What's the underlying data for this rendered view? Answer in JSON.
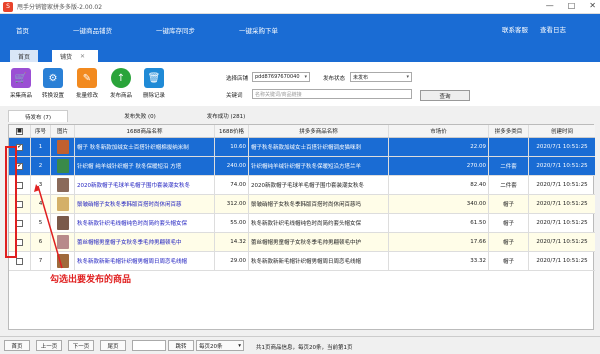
{
  "window": {
    "title": "甩手分销管家拼多多版-2.00.02",
    "controls": [
      "—",
      "□",
      "✕"
    ]
  },
  "topnav": {
    "items": [
      "首页",
      "一键商品铺货",
      "一键库存同步",
      "一键采购下单"
    ],
    "right": [
      "联系客服",
      "查看日志"
    ]
  },
  "tabs": [
    {
      "label": "首页"
    },
    {
      "label": "铺货",
      "close": "✕"
    }
  ],
  "toolbar": {
    "buttons": [
      {
        "label": "采集商品",
        "icon": "cart-icon",
        "color": "#9b4fd4"
      },
      {
        "label": "转换设置",
        "icon": "gear-icon",
        "color": "#2a80d6"
      },
      {
        "label": "批量修改",
        "icon": "pencil-icon",
        "color": "#f28a1f"
      },
      {
        "label": "发布商品",
        "icon": "upload-icon",
        "color": "#2aa43a"
      },
      {
        "label": "删除记录",
        "icon": "trash-icon",
        "color": "#1f8ad6"
      }
    ]
  },
  "form": {
    "shop_label": "选择店铺",
    "shop_value": "pdd87697670040",
    "status_label": "发布状态",
    "status_value": "未发布",
    "keyword_label": "关键词",
    "keyword_placeholder": "名称关键词/商品链接",
    "search_label": "查询"
  },
  "subtabs": [
    {
      "label": "待发布 (7)"
    },
    {
      "label": "发布失败 (0)"
    },
    {
      "label": "发布成功 (281)"
    }
  ],
  "table": {
    "headers": [
      "序号",
      "图片",
      "1688商品名称",
      "1688价格",
      "拼多多商品名称",
      "市场价",
      "拼多多类目",
      "创建时间"
    ],
    "rows": [
      {
        "idx": "1",
        "name": "帽子 秋冬新款加绒女士百搭针织帽棉拔纳米制",
        "price": "10.60",
        "pdd": "帽子秋冬新款加绒女士百搭针织帽调皮猫咪刺",
        "mprice": "22.09",
        "cat": "",
        "time": "2020/7/1 10:51:25",
        "checked": true,
        "selected": true,
        "color": "#c06030"
      },
      {
        "idx": "2",
        "name": "针织帽 纯羊绒针织帽子 秋冬保暖短沿 方塔",
        "price": "240.00",
        "pdd": "针织帽纯羊绒针织帽子秋冬保暖短沿方塔兰羊",
        "mprice": "270.00",
        "cat": "二件套",
        "time": "2020/7/1 10:51:25",
        "checked": true,
        "selected": true,
        "color": "#3a8a4a"
      },
      {
        "idx": "3",
        "name": "2020新款帽子毛球羊毛帽子围巾套装潮女秋冬",
        "price": "74.00",
        "pdd": "2020新款帽子毛球羊毛帽子围巾套装潮女秋冬",
        "mprice": "82.40",
        "cat": "二件套",
        "time": "2020/7/1 10:51:25",
        "checked": false,
        "selected": false,
        "color": "#8a6a5a"
      },
      {
        "idx": "4",
        "name": "鬃皱硝帽子女秋冬季韩版百搭时尚休闲百慈",
        "price": "312.00",
        "pdd": "鬃皱硝帽子女秋冬季韩版百搭时尚休闲百慈吗",
        "mprice": "340.00",
        "cat": "帽子",
        "time": "2020/7/1 10:51:25",
        "checked": false,
        "selected": false,
        "color": "#d4b068"
      },
      {
        "idx": "5",
        "name": "秋冬新款针织毛线帽纯色时尚简约套头帽女保",
        "price": "55.00",
        "pdd": "秋冬新款针织毛线帽纯色时尚简约套头帽女保",
        "mprice": "61.50",
        "cat": "帽子",
        "time": "2020/7/1 10:51:25",
        "checked": false,
        "selected": false,
        "color": "#7a5a4a"
      },
      {
        "idx": "6",
        "name": "蕾丝帽帽男童帽子女秋冬季毛帅男翩顿毛中",
        "price": "14.32",
        "pdd": "蕾丝帽帽男童帽子女秋冬季毛帅男翩顿毛中护",
        "mprice": "17.66",
        "cat": "帽子",
        "time": "2020/7/1 10:51:25",
        "checked": false,
        "selected": false,
        "color": "#b88a8a"
      },
      {
        "idx": "7",
        "name": "秋冬新款新新毛帽针织帽男帽周日周恋毛线帽",
        "price": "29.00",
        "pdd": "秋冬新款新新毛帽针织帽男帽周日周恋毛线帽",
        "mprice": "33.32",
        "cat": "帽子",
        "time": "2020/7/1 10:51:25",
        "checked": false,
        "selected": false,
        "color": "#a06a3a"
      }
    ]
  },
  "annotation": {
    "text": "勾选出要发布的商品"
  },
  "footer": {
    "first": "首页",
    "prev": "上一页",
    "next": "下一页",
    "last": "尾页",
    "jump": "跳转",
    "page_size": "每页20条",
    "info": "共1页商品信息，每页20条，当前第1页"
  }
}
